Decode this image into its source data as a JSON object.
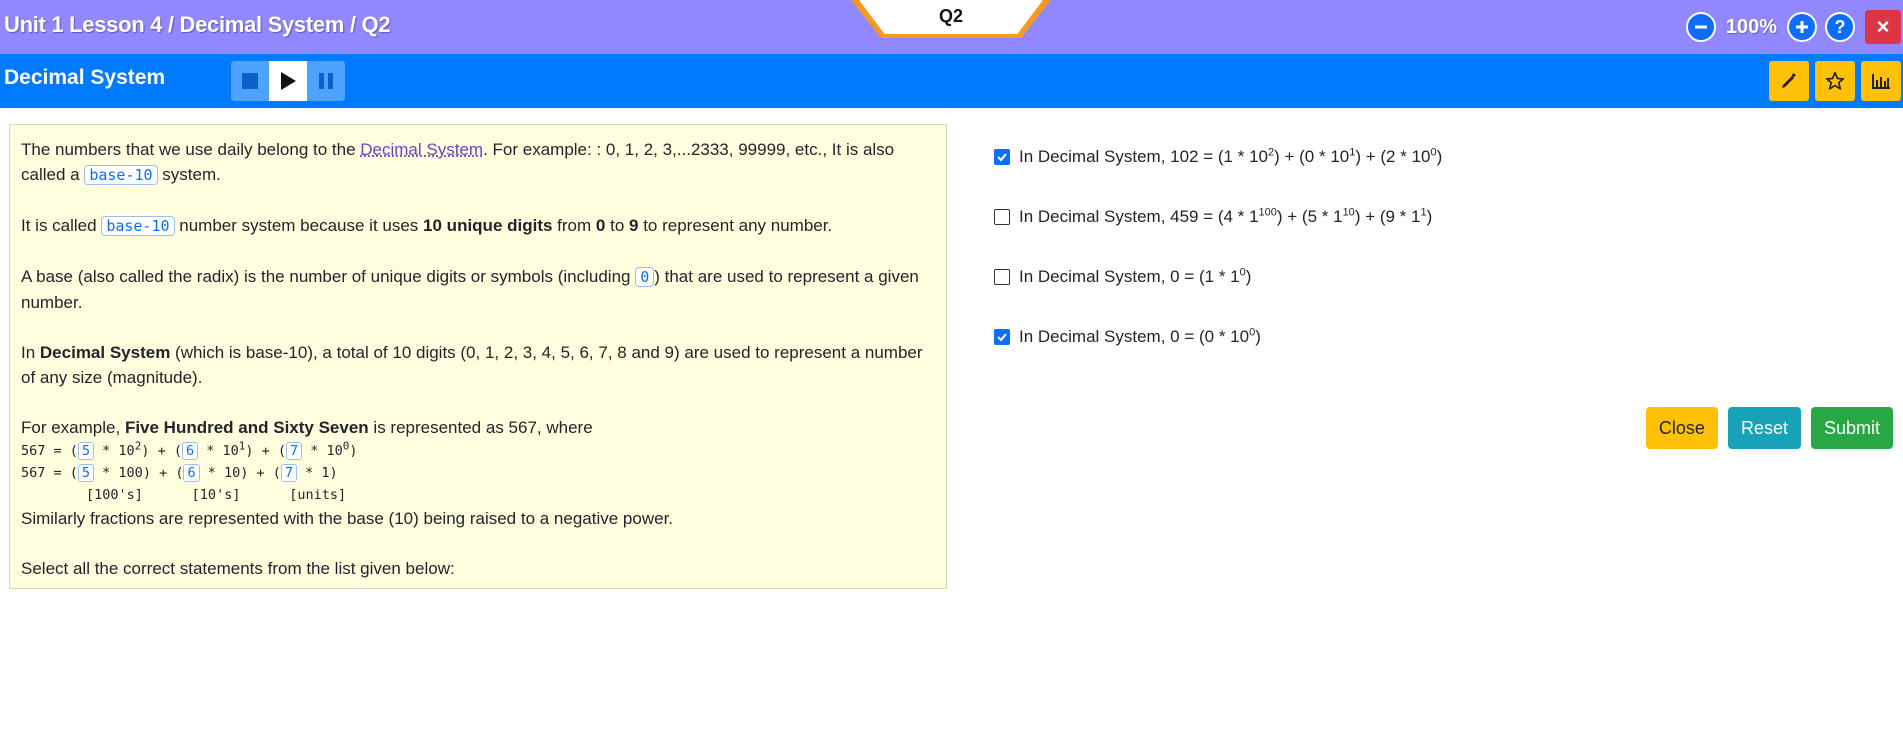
{
  "header": {
    "breadcrumb": "Unit 1 Lesson 4 / Decimal System / Q2",
    "question_tab": "Q2",
    "zoom": "100%",
    "help_label": "?",
    "close_label": "×"
  },
  "subheader": {
    "title": "Decimal System"
  },
  "question": {
    "p1a": "The numbers that we use daily belong to the ",
    "p1_link": "Decimal System",
    "p1b": ". For example: : 0, 1, 2, 3,...2333, 99999, etc., It is also called a ",
    "p1_code": "base-10",
    "p1c": " system.",
    "p2a": "It is called ",
    "p2_code": "base-10",
    "p2b": " number system because it uses ",
    "p2_bold1": "10 unique digits",
    "p2c": " from ",
    "p2_bold2": "0",
    "p2d": " to ",
    "p2_bold3": "9",
    "p2e": " to represent any number.",
    "p3a": "A base (also called the radix) is the number of unique digits or symbols (including ",
    "p3_code": "0",
    "p3b": ") that are used to represent a given number.",
    "p4a": "In ",
    "p4_bold": "Decimal System",
    "p4b": " (which is base-10), a total of 10 digits (0, 1, 2, 3, 4, 5, 6, 7, 8 and 9) are used to represent a number of any size (magnitude).",
    "p5a": "For example, ",
    "p5_bold": "Five Hundred and Sixty Seven",
    "p5b": " is represented as 567, where",
    "line1": {
      "pre": "567 = (",
      "d1": "5",
      "m1": " * 10",
      "e1": "2",
      "m2": ") + (",
      "d2": "6",
      "m3": " * 10",
      "e2": "1",
      "m4": ") + (",
      "d3": "7",
      "m5": " * 10",
      "e3": "0",
      "m6": ")"
    },
    "line2": {
      "pre": "567 = (",
      "d1": "5",
      "m1": " * 100) + (",
      "d2": "6",
      "m2": " * 10) + (",
      "d3": "7",
      "m3": " * 1)"
    },
    "line3": "        [100's]      [10's]      [units]",
    "p6": "Similarly fractions are represented with the base (10) being raised to a negative power.",
    "p7": "Select all the correct statements from the list given below:"
  },
  "options": [
    {
      "checked": true,
      "a": "In Decimal System, 102 = (1 * 10",
      "e1": "2",
      "b": ") + (0 * 10",
      "e2": "1",
      "c": ") + (2 * 10",
      "e3": "0",
      "d": ")"
    },
    {
      "checked": false,
      "a": "In Decimal System, 459 = (4 * 1",
      "e1": "100",
      "b": ") + (5 * 1",
      "e2": "10",
      "c": ") + (9 * 1",
      "e3": "1",
      "d": ")"
    },
    {
      "checked": false,
      "a": "In Decimal System, 0 = (1 * 1",
      "e1": "0",
      "b": ")"
    },
    {
      "checked": true,
      "a": "In Decimal System, 0 = (0 * 10",
      "e1": "0",
      "b": ")"
    }
  ],
  "actions": {
    "close": "Close",
    "reset": "Reset",
    "submit": "Submit"
  },
  "colors": {
    "topbar": "#9187ff",
    "subbar": "#007bff",
    "question_bg": "#ffffe0",
    "accent_orange": "#f29b1d"
  },
  "icons": [
    "minus-circle-icon",
    "plus-circle-icon",
    "stop-icon",
    "play-icon",
    "pause-icon",
    "pencil-icon",
    "star-icon",
    "bar-chart-icon"
  ]
}
